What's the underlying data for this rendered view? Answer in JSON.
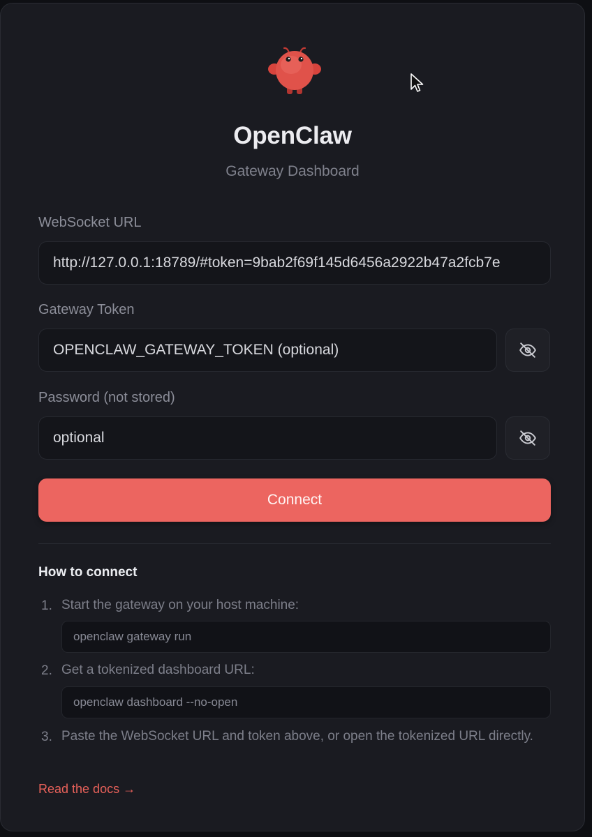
{
  "header": {
    "title": "OpenClaw",
    "subtitle": "Gateway Dashboard"
  },
  "form": {
    "websocket_url": {
      "label": "WebSocket URL",
      "value": "http://127.0.0.1:18789/#token=9bab2f69f145d6456a2922b47a2fcb7e"
    },
    "gateway_token": {
      "label": "Gateway Token",
      "placeholder": "OPENCLAW_GATEWAY_TOKEN (optional)",
      "toggle_icon": "eye-off-icon"
    },
    "password": {
      "label": "Password (not stored)",
      "placeholder": "optional",
      "toggle_icon": "eye-off-icon"
    },
    "connect_label": "Connect"
  },
  "help": {
    "heading": "How to connect",
    "steps": [
      {
        "num": "1.",
        "text": "Start the gateway on your host machine:",
        "code": "openclaw gateway run"
      },
      {
        "num": "2.",
        "text": "Get a tokenized dashboard URL:",
        "code": "openclaw dashboard --no-open"
      },
      {
        "num": "3.",
        "text": "Paste the WebSocket URL and token above, or open the tokenized URL directly."
      }
    ],
    "docs_link": "Read the docs →"
  },
  "colors": {
    "accent": "#ec6560",
    "background": "#1a1b21",
    "link": "#e8615a"
  },
  "icons": {
    "logo": "red-claw-mascot-icon"
  }
}
